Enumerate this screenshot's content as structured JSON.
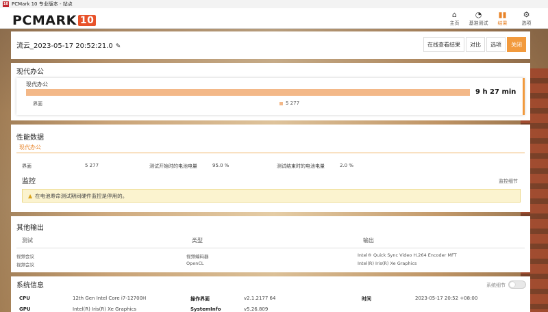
{
  "window": {
    "title": "PCMark 10 专业版本 - 站点",
    "icon_text": "10"
  },
  "header": {
    "logo_text": "PCMARK",
    "logo_number": "10",
    "nav": [
      {
        "label": "主页",
        "icon": "home-icon"
      },
      {
        "label": "基准测试",
        "icon": "gauge-icon"
      },
      {
        "label": "结果",
        "icon": "bar-chart-icon",
        "active": true
      },
      {
        "label": "选项",
        "icon": "gear-icon"
      }
    ]
  },
  "title_panel": {
    "run_name": "流云_2023-05-17 20:52:21.0",
    "buttons": [
      "在线查看结果",
      "对比",
      "选项",
      "关闭"
    ]
  },
  "office": {
    "section_title": "现代办公",
    "card_label": "现代办公",
    "score_text": "9 h 27 min",
    "bar_fraction": 1.0,
    "legend_name": "界面",
    "legend_value": "5 277",
    "bar_color": "#f3b888"
  },
  "perf": {
    "section_title": "性能数据",
    "tab_label": "现代办公",
    "rows": [
      {
        "key": "界面",
        "value": "5 277"
      },
      {
        "key": "测试开始时的电池电量",
        "value": "95.0 %"
      },
      {
        "key": "测试结束时的电池电量",
        "value": "2.0 %"
      }
    ],
    "monitor_title": "监控",
    "monitor_link": "监控细节",
    "warning_text": "在电池寿命测试期间硬件监控是停用的。"
  },
  "other": {
    "section_title": "其他输出",
    "headers": [
      "测试",
      "类型",
      "输出"
    ],
    "rows": [
      [
        "视频会议",
        "视频编码器",
        "Intel® Quick Sync Video H.264 Encoder MFT"
      ],
      [
        "视频会议",
        "OpenCL",
        "Intel(R) Iris(R) Xe Graphics"
      ]
    ]
  },
  "system": {
    "section_title": "系统信息",
    "toggle_label": "系统细节",
    "row1": [
      {
        "key": "CPU",
        "value": "12th Gen Intel Core i7-12700H"
      },
      {
        "key": "操作界面",
        "value": "v2.1.2177 64"
      },
      {
        "key": "时间",
        "value": "2023-05-17 20:52 +08:00"
      }
    ],
    "row2": [
      {
        "key": "GPU",
        "value": "Intel(R) Iris(R) Xe Graphics"
      },
      {
        "key": "SystemInfo",
        "value": "v5.26.809"
      }
    ]
  },
  "colors": {
    "accent": "#f29a3d",
    "brand": "#e8522a"
  }
}
